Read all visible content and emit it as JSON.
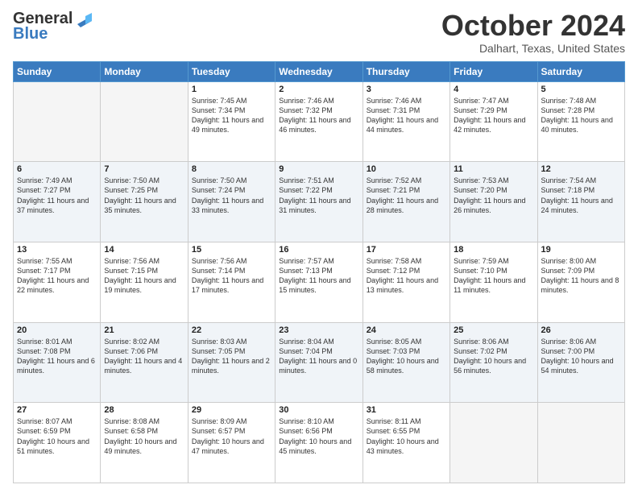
{
  "header": {
    "logo_line1": "General",
    "logo_line2": "Blue",
    "month_title": "October 2024",
    "location": "Dalhart, Texas, United States"
  },
  "weekdays": [
    "Sunday",
    "Monday",
    "Tuesday",
    "Wednesday",
    "Thursday",
    "Friday",
    "Saturday"
  ],
  "weeks": [
    [
      {
        "day": "",
        "sunrise": "",
        "sunset": "",
        "daylight": "",
        "empty": true
      },
      {
        "day": "",
        "sunrise": "",
        "sunset": "",
        "daylight": "",
        "empty": true
      },
      {
        "day": "1",
        "sunrise": "Sunrise: 7:45 AM",
        "sunset": "Sunset: 7:34 PM",
        "daylight": "Daylight: 11 hours and 49 minutes.",
        "empty": false
      },
      {
        "day": "2",
        "sunrise": "Sunrise: 7:46 AM",
        "sunset": "Sunset: 7:32 PM",
        "daylight": "Daylight: 11 hours and 46 minutes.",
        "empty": false
      },
      {
        "day": "3",
        "sunrise": "Sunrise: 7:46 AM",
        "sunset": "Sunset: 7:31 PM",
        "daylight": "Daylight: 11 hours and 44 minutes.",
        "empty": false
      },
      {
        "day": "4",
        "sunrise": "Sunrise: 7:47 AM",
        "sunset": "Sunset: 7:29 PM",
        "daylight": "Daylight: 11 hours and 42 minutes.",
        "empty": false
      },
      {
        "day": "5",
        "sunrise": "Sunrise: 7:48 AM",
        "sunset": "Sunset: 7:28 PM",
        "daylight": "Daylight: 11 hours and 40 minutes.",
        "empty": false
      }
    ],
    [
      {
        "day": "6",
        "sunrise": "Sunrise: 7:49 AM",
        "sunset": "Sunset: 7:27 PM",
        "daylight": "Daylight: 11 hours and 37 minutes.",
        "empty": false
      },
      {
        "day": "7",
        "sunrise": "Sunrise: 7:50 AM",
        "sunset": "Sunset: 7:25 PM",
        "daylight": "Daylight: 11 hours and 35 minutes.",
        "empty": false
      },
      {
        "day": "8",
        "sunrise": "Sunrise: 7:50 AM",
        "sunset": "Sunset: 7:24 PM",
        "daylight": "Daylight: 11 hours and 33 minutes.",
        "empty": false
      },
      {
        "day": "9",
        "sunrise": "Sunrise: 7:51 AM",
        "sunset": "Sunset: 7:22 PM",
        "daylight": "Daylight: 11 hours and 31 minutes.",
        "empty": false
      },
      {
        "day": "10",
        "sunrise": "Sunrise: 7:52 AM",
        "sunset": "Sunset: 7:21 PM",
        "daylight": "Daylight: 11 hours and 28 minutes.",
        "empty": false
      },
      {
        "day": "11",
        "sunrise": "Sunrise: 7:53 AM",
        "sunset": "Sunset: 7:20 PM",
        "daylight": "Daylight: 11 hours and 26 minutes.",
        "empty": false
      },
      {
        "day": "12",
        "sunrise": "Sunrise: 7:54 AM",
        "sunset": "Sunset: 7:18 PM",
        "daylight": "Daylight: 11 hours and 24 minutes.",
        "empty": false
      }
    ],
    [
      {
        "day": "13",
        "sunrise": "Sunrise: 7:55 AM",
        "sunset": "Sunset: 7:17 PM",
        "daylight": "Daylight: 11 hours and 22 minutes.",
        "empty": false
      },
      {
        "day": "14",
        "sunrise": "Sunrise: 7:56 AM",
        "sunset": "Sunset: 7:15 PM",
        "daylight": "Daylight: 11 hours and 19 minutes.",
        "empty": false
      },
      {
        "day": "15",
        "sunrise": "Sunrise: 7:56 AM",
        "sunset": "Sunset: 7:14 PM",
        "daylight": "Daylight: 11 hours and 17 minutes.",
        "empty": false
      },
      {
        "day": "16",
        "sunrise": "Sunrise: 7:57 AM",
        "sunset": "Sunset: 7:13 PM",
        "daylight": "Daylight: 11 hours and 15 minutes.",
        "empty": false
      },
      {
        "day": "17",
        "sunrise": "Sunrise: 7:58 AM",
        "sunset": "Sunset: 7:12 PM",
        "daylight": "Daylight: 11 hours and 13 minutes.",
        "empty": false
      },
      {
        "day": "18",
        "sunrise": "Sunrise: 7:59 AM",
        "sunset": "Sunset: 7:10 PM",
        "daylight": "Daylight: 11 hours and 11 minutes.",
        "empty": false
      },
      {
        "day": "19",
        "sunrise": "Sunrise: 8:00 AM",
        "sunset": "Sunset: 7:09 PM",
        "daylight": "Daylight: 11 hours and 8 minutes.",
        "empty": false
      }
    ],
    [
      {
        "day": "20",
        "sunrise": "Sunrise: 8:01 AM",
        "sunset": "Sunset: 7:08 PM",
        "daylight": "Daylight: 11 hours and 6 minutes.",
        "empty": false
      },
      {
        "day": "21",
        "sunrise": "Sunrise: 8:02 AM",
        "sunset": "Sunset: 7:06 PM",
        "daylight": "Daylight: 11 hours and 4 minutes.",
        "empty": false
      },
      {
        "day": "22",
        "sunrise": "Sunrise: 8:03 AM",
        "sunset": "Sunset: 7:05 PM",
        "daylight": "Daylight: 11 hours and 2 minutes.",
        "empty": false
      },
      {
        "day": "23",
        "sunrise": "Sunrise: 8:04 AM",
        "sunset": "Sunset: 7:04 PM",
        "daylight": "Daylight: 11 hours and 0 minutes.",
        "empty": false
      },
      {
        "day": "24",
        "sunrise": "Sunrise: 8:05 AM",
        "sunset": "Sunset: 7:03 PM",
        "daylight": "Daylight: 10 hours and 58 minutes.",
        "empty": false
      },
      {
        "day": "25",
        "sunrise": "Sunrise: 8:06 AM",
        "sunset": "Sunset: 7:02 PM",
        "daylight": "Daylight: 10 hours and 56 minutes.",
        "empty": false
      },
      {
        "day": "26",
        "sunrise": "Sunrise: 8:06 AM",
        "sunset": "Sunset: 7:00 PM",
        "daylight": "Daylight: 10 hours and 54 minutes.",
        "empty": false
      }
    ],
    [
      {
        "day": "27",
        "sunrise": "Sunrise: 8:07 AM",
        "sunset": "Sunset: 6:59 PM",
        "daylight": "Daylight: 10 hours and 51 minutes.",
        "empty": false
      },
      {
        "day": "28",
        "sunrise": "Sunrise: 8:08 AM",
        "sunset": "Sunset: 6:58 PM",
        "daylight": "Daylight: 10 hours and 49 minutes.",
        "empty": false
      },
      {
        "day": "29",
        "sunrise": "Sunrise: 8:09 AM",
        "sunset": "Sunset: 6:57 PM",
        "daylight": "Daylight: 10 hours and 47 minutes.",
        "empty": false
      },
      {
        "day": "30",
        "sunrise": "Sunrise: 8:10 AM",
        "sunset": "Sunset: 6:56 PM",
        "daylight": "Daylight: 10 hours and 45 minutes.",
        "empty": false
      },
      {
        "day": "31",
        "sunrise": "Sunrise: 8:11 AM",
        "sunset": "Sunset: 6:55 PM",
        "daylight": "Daylight: 10 hours and 43 minutes.",
        "empty": false
      },
      {
        "day": "",
        "sunrise": "",
        "sunset": "",
        "daylight": "",
        "empty": true
      },
      {
        "day": "",
        "sunrise": "",
        "sunset": "",
        "daylight": "",
        "empty": true
      }
    ]
  ]
}
